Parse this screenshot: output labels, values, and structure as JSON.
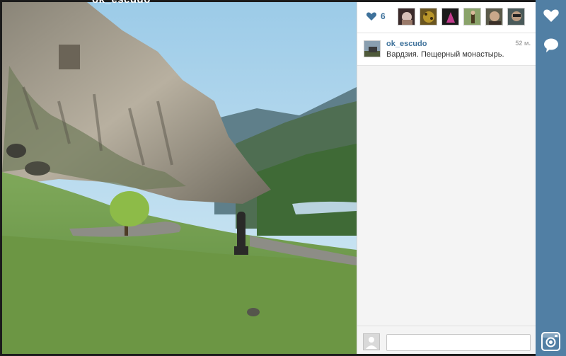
{
  "photo": {
    "caption_overlay": "ok_escudo"
  },
  "likes": {
    "count": "6",
    "likers": [
      "liker-1-avatar",
      "liker-2-avatar",
      "liker-3-avatar",
      "liker-4-avatar",
      "liker-5-avatar",
      "liker-6-avatar"
    ]
  },
  "comment": {
    "username": "ok_escudo",
    "time": "52 м.",
    "text": "Вардзия. Пещерный монастырь."
  },
  "comment_input": {
    "placeholder": ""
  },
  "icons": {
    "like": "heart-icon",
    "comment": "speech-bubble-icon",
    "logo": "instagram-icon"
  },
  "colors": {
    "accent": "#517fa4",
    "link": "#3f729b"
  }
}
